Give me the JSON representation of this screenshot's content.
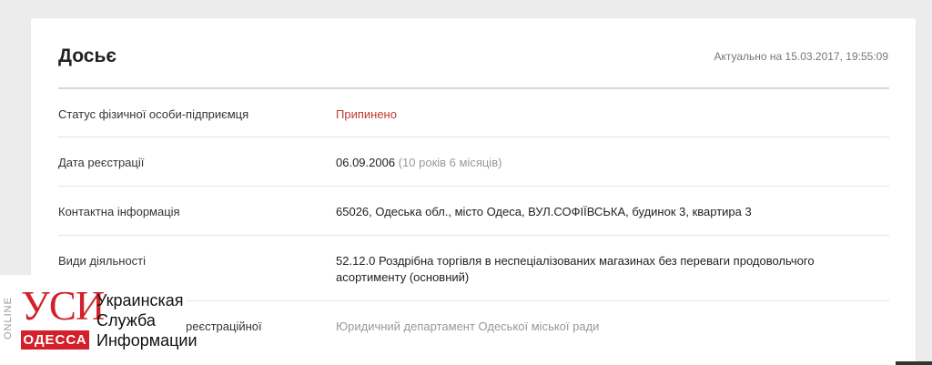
{
  "dossier": {
    "title": "Досьє",
    "updated": "Актуально на 15.03.2017, 19:55:09",
    "rows": [
      {
        "label": "Статус фізичної особи-підприємця",
        "value": "Припинено"
      },
      {
        "label": "Дата реєстрації",
        "value": "06.09.2006",
        "extra": "(10 років 6 місяців)"
      },
      {
        "label": "Контактна інформація",
        "value": "65026, Одеська обл., місто Одеса, ВУЛ.СОФІЇВСЬКА, будинок 3, квартира 3"
      },
      {
        "label": "Види діяльності",
        "value": "52.12.0 Роздрібна торгівля в неспеціалізованих магазинах без переваги продовольчого асортименту (основний)"
      },
      {
        "label": "реєстраційної",
        "value": "Юридичний департамент Одеської міської ради"
      }
    ]
  },
  "logo": {
    "online": "ONLINE",
    "brand": "УСИ",
    "city": "ОДЕССА",
    "words": [
      "Украинская",
      "Служба",
      "Информации"
    ]
  },
  "colors": {
    "accent_red": "#c0392b",
    "logo_red": "#d3202a",
    "background": "#ececec",
    "card": "#ffffff"
  }
}
